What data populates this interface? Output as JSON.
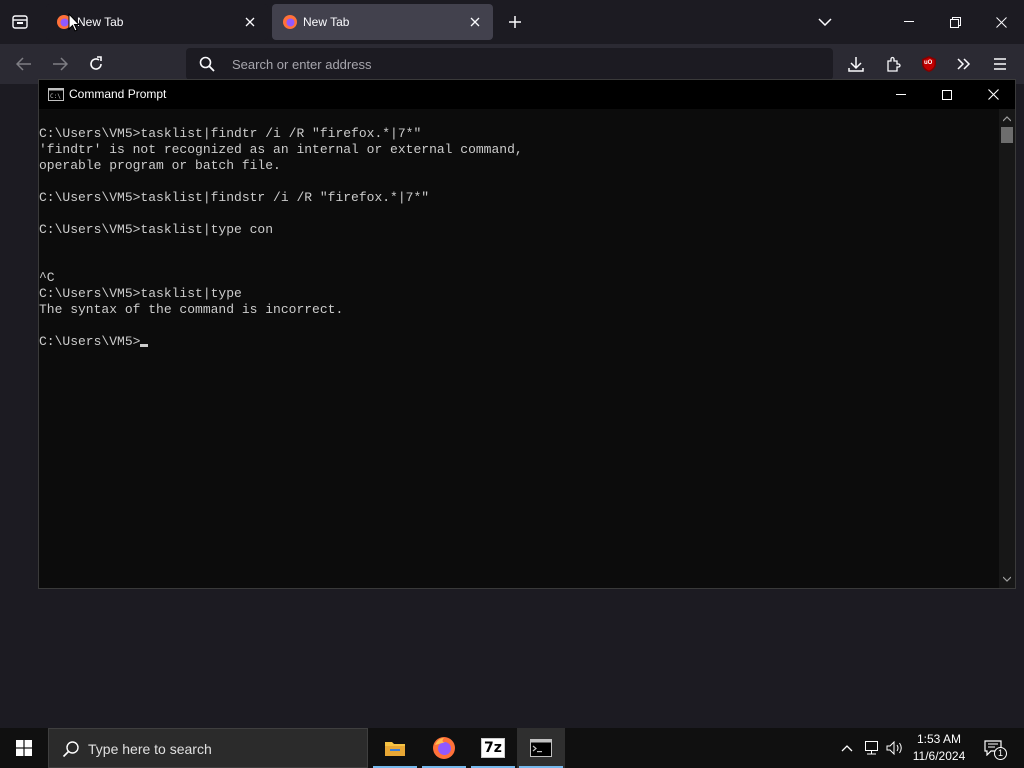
{
  "browser": {
    "tabs": [
      {
        "label": "New Tab",
        "active": false
      },
      {
        "label": "New Tab",
        "active": true
      }
    ],
    "address_placeholder": "Search or enter address",
    "toolbar_icons": [
      "back-arrow-icon",
      "forward-arrow-icon",
      "reload-icon",
      "download-icon",
      "extensions-icon",
      "ublock-origin-icon",
      "overflow-chevrons-icon",
      "hamburger-menu-icon"
    ],
    "extension_badge_label": "uO"
  },
  "cmd": {
    "title": "Command Prompt",
    "lines": [
      "C:\\Users\\VM5>tasklist|findtr /i /R \"firefox.*|7*\"",
      "'findtr' is not recognized as an internal or external command,",
      "operable program or batch file.",
      "",
      "C:\\Users\\VM5>tasklist|findstr /i /R \"firefox.*|7*\"",
      "",
      "C:\\Users\\VM5>tasklist|type con",
      "",
      "",
      "^C",
      "C:\\Users\\VM5>tasklist|type",
      "The syntax of the command is incorrect.",
      ""
    ],
    "prompt": "C:\\Users\\VM5>",
    "text_color": "#cccccc",
    "background": "#0c0c0c"
  },
  "taskbar": {
    "search_placeholder": "Type here to search",
    "apps": [
      {
        "name": "file-explorer",
        "active": false
      },
      {
        "name": "firefox",
        "active": false
      },
      {
        "name": "7-zip",
        "label": "7z",
        "active": false
      },
      {
        "name": "command-prompt",
        "active": true
      }
    ],
    "time": "1:53 AM",
    "date": "11/6/2024",
    "notification_count": "1"
  },
  "colors": {
    "accent": "#76b9ed",
    "firefox_tab_active": "#42414d",
    "firefox_toolbar": "#2b2a33",
    "firefox_frame": "#1c1b22"
  }
}
